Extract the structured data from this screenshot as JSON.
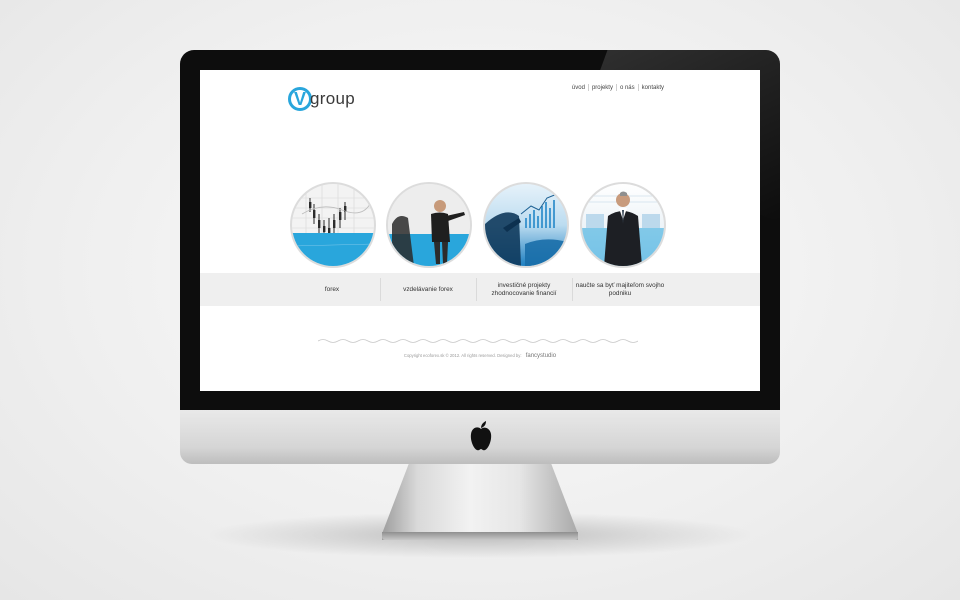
{
  "brand": {
    "logo_letter": "V",
    "logo_word": "group",
    "accent_color": "#29a6dc"
  },
  "nav": [
    "úvod",
    "projekty",
    "o nás",
    "kontakty"
  ],
  "features": [
    {
      "label": "forex",
      "image": "stock-chart-photo"
    },
    {
      "label": "vzdelávanie forex",
      "image": "presenter-photo"
    },
    {
      "label": "investičné projekty zhodnocovanie financií",
      "image": "meeting-chart-photo"
    },
    {
      "label": "naučte sa byť majiteľom svojho podniku",
      "image": "businessman-photo"
    }
  ],
  "footer": {
    "copyright": "Copyright ecoforex.sk © 2012. All rights reserved. Designed by:",
    "designer": "fancystudio"
  }
}
